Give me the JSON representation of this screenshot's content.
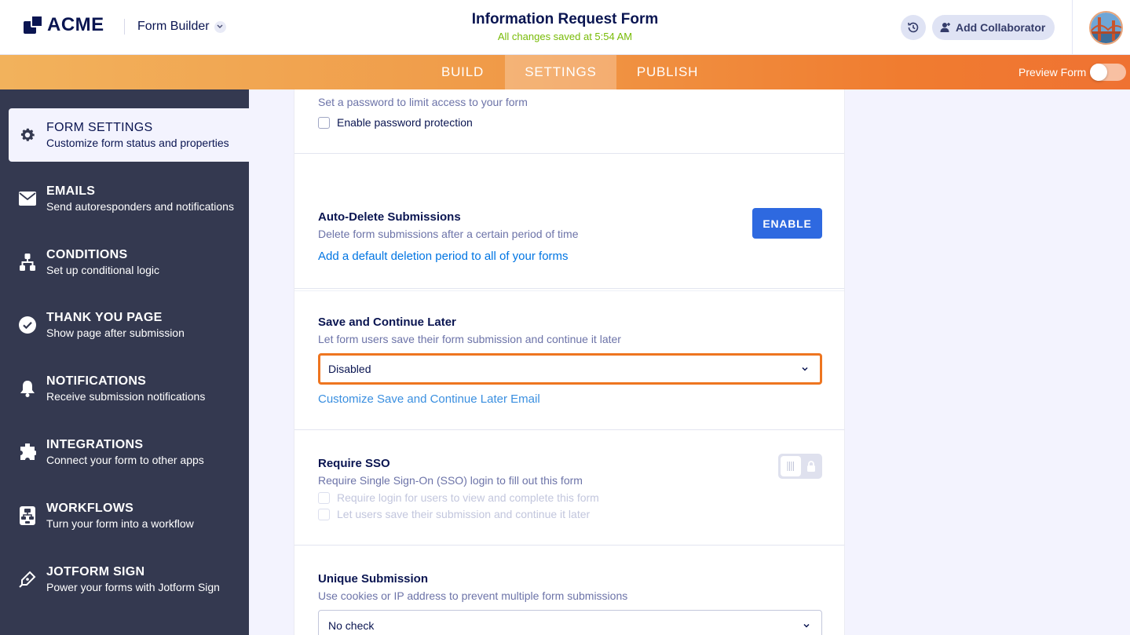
{
  "header": {
    "brand": "ACME",
    "builder_label": "Form Builder",
    "form_title": "Information Request Form",
    "save_status": "All changes saved at 5:54 AM",
    "add_collaborator": "Add Collaborator"
  },
  "nav": {
    "tabs": [
      {
        "label": "BUILD",
        "active": false
      },
      {
        "label": "SETTINGS",
        "active": true
      },
      {
        "label": "PUBLISH",
        "active": false
      }
    ],
    "preview_label": "Preview Form",
    "preview_enabled": false
  },
  "sidebar": {
    "items": [
      {
        "title": "FORM SETTINGS",
        "subtitle": "Customize form status and properties",
        "icon": "gear-icon",
        "active": true
      },
      {
        "title": "EMAILS",
        "subtitle": "Send autoresponders and notifications",
        "icon": "envelope-icon",
        "active": false
      },
      {
        "title": "CONDITIONS",
        "subtitle": "Set up conditional logic",
        "icon": "hierarchy-icon",
        "active": false
      },
      {
        "title": "THANK YOU PAGE",
        "subtitle": "Show page after submission",
        "icon": "check-circle-icon",
        "active": false
      },
      {
        "title": "NOTIFICATIONS",
        "subtitle": "Receive submission notifications",
        "icon": "bell-icon",
        "active": false
      },
      {
        "title": "INTEGRATIONS",
        "subtitle": "Connect your form to other apps",
        "icon": "puzzle-icon",
        "active": false
      },
      {
        "title": "WORKFLOWS",
        "subtitle": "Turn your form into a workflow",
        "icon": "workflow-icon",
        "active": false
      },
      {
        "title": "JOTFORM SIGN",
        "subtitle": "Power your forms with Jotform Sign",
        "icon": "pen-icon",
        "active": false
      }
    ]
  },
  "settings": {
    "password": {
      "description": "Set a password to limit access to your form",
      "checkbox_label": "Enable password protection",
      "checked": false
    },
    "auto_delete": {
      "title": "Auto-Delete Submissions",
      "description": "Delete form submissions after a certain period of time",
      "button": "ENABLE",
      "link": "Add a default deletion period to all of your forms"
    },
    "save_continue": {
      "title": "Save and Continue Later",
      "description": "Let form users save their form submission and continue it later",
      "selected": "Disabled",
      "link": "Customize Save and Continue Later Email"
    },
    "sso": {
      "title": "Require SSO",
      "description": "Require Single Sign-On (SSO) login to fill out this form",
      "enabled": false,
      "option1": "Require login for users to view and complete this form",
      "option2": "Let users save their submission and continue it later"
    },
    "unique": {
      "title": "Unique Submission",
      "description": "Use cookies or IP address to prevent multiple form submissions",
      "selected": "No check"
    }
  },
  "colors": {
    "accent_orange": "#ee7520",
    "primary_blue": "#2e69e0",
    "sidebar_bg": "#343950",
    "saved_green": "#78bb07"
  }
}
